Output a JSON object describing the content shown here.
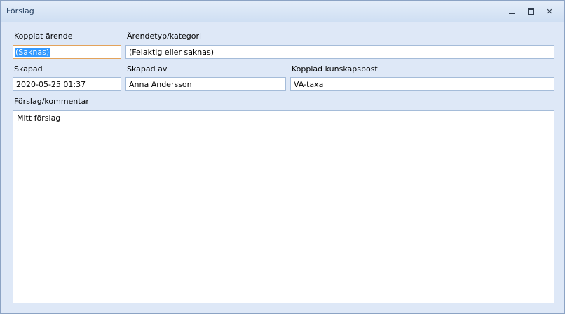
{
  "window": {
    "title": "Förslag"
  },
  "form": {
    "kopplat_arende": {
      "label": "Kopplat ärende",
      "value": "(Saknas)"
    },
    "arendetyp": {
      "label": "Ärendetyp/kategori",
      "value": "(Felaktig eller saknas)"
    },
    "skapad": {
      "label": "Skapad",
      "value": "2020-05-25 01:37"
    },
    "skapad_av": {
      "label": "Skapad av",
      "value": "Anna Andersson"
    },
    "kunskapspost": {
      "label": "Kopplad kunskapspost",
      "value": "VA-taxa"
    },
    "kommentar": {
      "label": "Förslag/kommentar",
      "value": "Mitt förslag"
    }
  },
  "icons": {
    "minimize": "minimize-icon",
    "maximize": "maximize-icon",
    "close": "close-icon"
  }
}
